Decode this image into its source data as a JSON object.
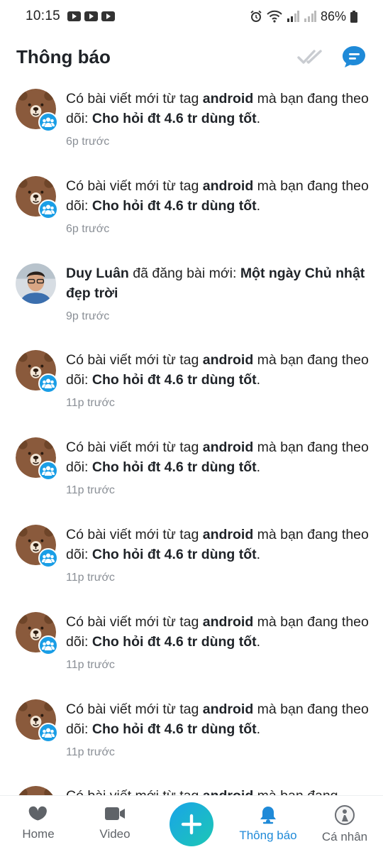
{
  "status_bar": {
    "time": "10:15",
    "battery": "86%"
  },
  "header": {
    "title": "Thông báo",
    "icons": [
      "double-check-icon",
      "message-icon"
    ]
  },
  "notifications": [
    {
      "type": "tag",
      "t1": "Có bài viết mới từ tag ",
      "tag": "android",
      "t2": " mà bạn đang theo dõi: ",
      "post": "Cho hỏi đt 4.6 tr dùng tốt",
      "t3": ".",
      "time": "6p trước"
    },
    {
      "type": "tag",
      "t1": "Có bài viết mới từ tag ",
      "tag": "android",
      "t2": " mà bạn đang theo dõi: ",
      "post": "Cho hỏi đt 4.6 tr dùng tốt",
      "t3": ".",
      "time": "6p trước"
    },
    {
      "type": "user",
      "user": "Duy Luân",
      "t1": " đã đăng bài mới: ",
      "post": "Một ngày Chủ nhật đẹp trời",
      "time": "9p trước"
    },
    {
      "type": "tag",
      "t1": "Có bài viết mới từ tag ",
      "tag": "android",
      "t2": " mà bạn đang theo dõi: ",
      "post": "Cho hỏi đt 4.6 tr dùng tốt",
      "t3": ".",
      "time": "11p trước"
    },
    {
      "type": "tag",
      "t1": "Có bài viết mới từ tag ",
      "tag": "android",
      "t2": " mà bạn đang theo dõi: ",
      "post": "Cho hỏi đt 4.6 tr dùng tốt",
      "t3": ".",
      "time": "11p trước"
    },
    {
      "type": "tag",
      "t1": "Có bài viết mới từ tag ",
      "tag": "android",
      "t2": " mà bạn đang theo dõi: ",
      "post": "Cho hỏi đt 4.6 tr dùng tốt",
      "t3": ".",
      "time": "11p trước"
    },
    {
      "type": "tag",
      "t1": "Có bài viết mới từ tag ",
      "tag": "android",
      "t2": " mà bạn đang theo dõi: ",
      "post": "Cho hỏi đt 4.6 tr dùng tốt",
      "t3": ".",
      "time": "11p trước"
    },
    {
      "type": "tag",
      "t1": "Có bài viết mới từ tag ",
      "tag": "android",
      "t2": " mà bạn đang theo dõi: ",
      "post": "Cho hỏi đt 4.6 tr dùng tốt",
      "t3": ".",
      "time": "11p trước"
    },
    {
      "type": "tag",
      "t1": "Có bài viết mới từ tag ",
      "tag": "android",
      "t2": " mà bạn đang",
      "post": "",
      "t3": "",
      "time": ""
    }
  ],
  "bottom_nav": {
    "items": [
      {
        "label": "Home",
        "icon": "home-icon"
      },
      {
        "label": "Video",
        "icon": "video-icon"
      },
      {
        "label": "",
        "icon": "plus-icon"
      },
      {
        "label": "Thông báo",
        "icon": "bell-icon"
      },
      {
        "label": "Cá nhân",
        "icon": "profile-icon"
      }
    ]
  },
  "colors": {
    "accent": "#1f8ad8",
    "badge": "#1a9ee6",
    "fab_start": "#1aa4e8",
    "fab_end": "#1cc7b5",
    "bear": "#8a5a3c"
  }
}
